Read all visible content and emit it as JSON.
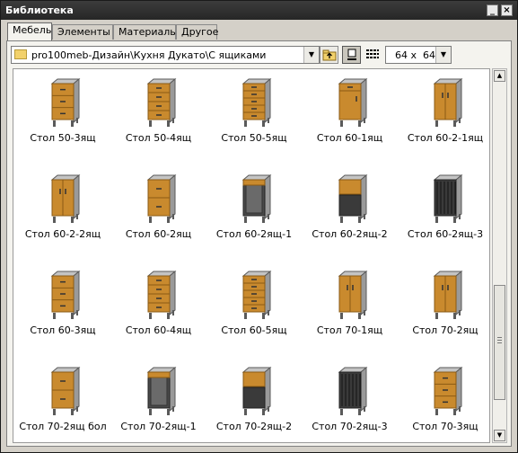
{
  "window": {
    "title": "Библиотека",
    "min_icon": "minimize-icon",
    "close_icon": "close-icon"
  },
  "tabs": [
    {
      "label": "Мебель",
      "active": true
    },
    {
      "label": "Элементы",
      "active": false
    },
    {
      "label": "Материалы",
      "active": false
    },
    {
      "label": "Другое",
      "active": false
    }
  ],
  "toolbar": {
    "path": "pro100meb-Дизайн\\Кухня Дукато\\С ящиками",
    "size_value": "64 x  64"
  },
  "colors": {
    "wood": "#c98a2e",
    "wood_dark": "#8a5a14",
    "body": "#9a9a9a",
    "body_dark": "#5a5a5a",
    "titlebar": "#2f2f2f"
  },
  "items": [
    {
      "label": "Стол 50-3ящ",
      "style": "drawers3"
    },
    {
      "label": "Стол 50-4ящ",
      "style": "drawers4"
    },
    {
      "label": "Стол 50-5ящ",
      "style": "drawers5"
    },
    {
      "label": "Стол 60-1ящ",
      "style": "door1"
    },
    {
      "label": "Стол 60-2-1ящ",
      "style": "door2"
    },
    {
      "label": "Стол 60-2-2ящ",
      "style": "door2"
    },
    {
      "label": "Стол 60-2ящ",
      "style": "drawers2"
    },
    {
      "label": "Стол 60-2ящ-1",
      "style": "open"
    },
    {
      "label": "Стол 60-2ящ-2",
      "style": "half"
    },
    {
      "label": "Стол 60-2ящ-3",
      "style": "dark"
    },
    {
      "label": "Стол 60-3ящ",
      "style": "drawers3"
    },
    {
      "label": "Стол 60-4ящ",
      "style": "drawers4"
    },
    {
      "label": "Стол 60-5ящ",
      "style": "drawers5"
    },
    {
      "label": "Стол 70-1ящ",
      "style": "door2"
    },
    {
      "label": "Стол 70-2ящ",
      "style": "door2"
    },
    {
      "label": "Стол 70-2ящ бол",
      "style": "drawers2"
    },
    {
      "label": "Стол 70-2ящ-1",
      "style": "open"
    },
    {
      "label": "Стол 70-2ящ-2",
      "style": "half"
    },
    {
      "label": "Стол 70-2ящ-3",
      "style": "dark"
    },
    {
      "label": "Стол 70-3ящ",
      "style": "drawers3"
    }
  ]
}
